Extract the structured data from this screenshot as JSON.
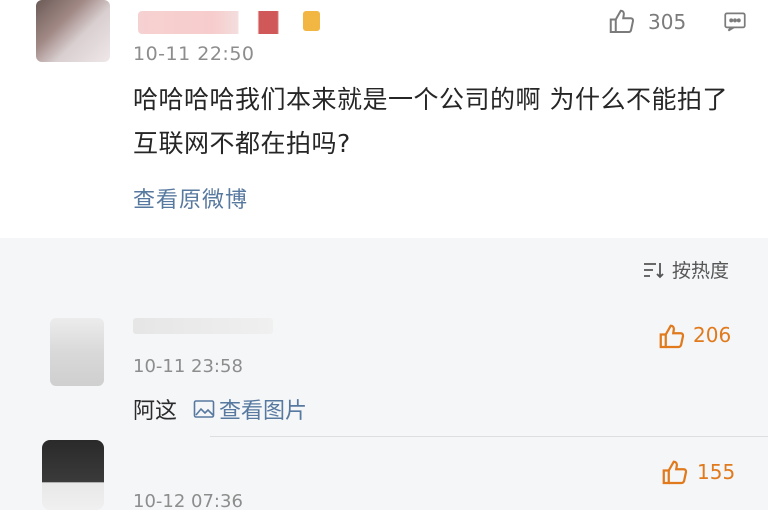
{
  "post": {
    "time": "10-11 22:50",
    "likes": "305",
    "text": "哈哈哈哈我们本来就是一个公司的啊 为什么不能拍了 互联网不都在拍吗?",
    "view_original": "查看原微博",
    "icons": [
      "avatar",
      "vip-badge",
      "thumbs-up-icon",
      "comment-icon"
    ]
  },
  "sort": {
    "label": "按热度",
    "icon": "sort-icon"
  },
  "comments": [
    {
      "time": "10-11 23:58",
      "likes": "206",
      "text": "阿这",
      "link": "查看图片",
      "link_icon": "image-icon"
    },
    {
      "time": "10-12 07:36",
      "likes": "155"
    }
  ],
  "colors": {
    "link": "#58799f",
    "meta": "#8d8d8d",
    "like_orange": "#e07a1c",
    "section_bg": "#f5f6f8"
  }
}
